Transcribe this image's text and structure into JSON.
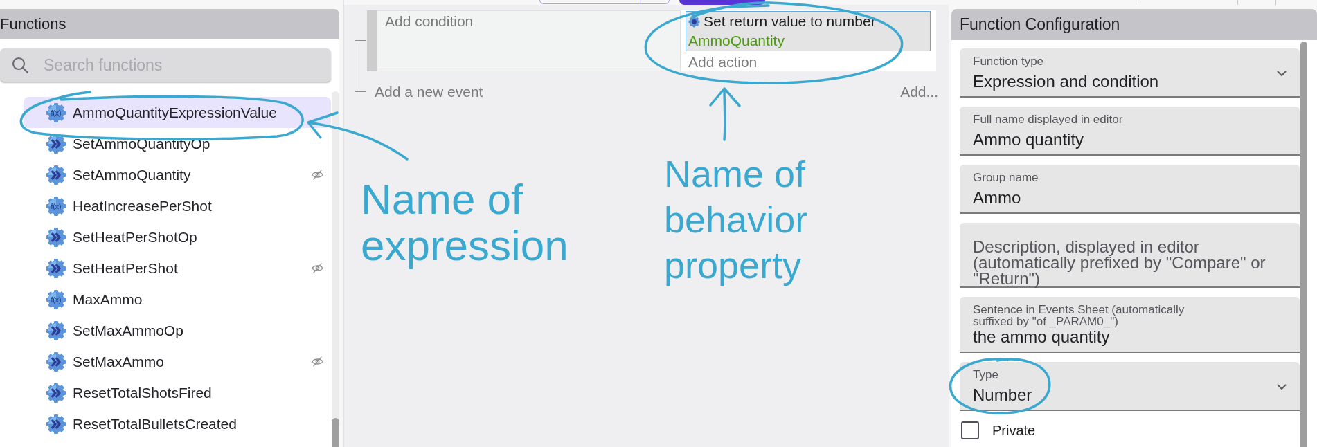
{
  "functions_panel": {
    "title": "Functions",
    "search": {
      "placeholder": "Search functions"
    },
    "items": [
      {
        "name": "AmmoQuantityExpressionValue",
        "kind": "expression",
        "icon_text": "f(x)",
        "selected": true,
        "private": false
      },
      {
        "name": "SetAmmoQuantityOp",
        "kind": "action",
        "selected": false,
        "private": false
      },
      {
        "name": "SetAmmoQuantity",
        "kind": "action",
        "selected": false,
        "private": true
      },
      {
        "name": "HeatIncreasePerShot",
        "kind": "expression",
        "icon_text": "f(x)",
        "selected": false,
        "private": false
      },
      {
        "name": "SetHeatPerShotOp",
        "kind": "action",
        "selected": false,
        "private": false
      },
      {
        "name": "SetHeatPerShot",
        "kind": "action",
        "selected": false,
        "private": true
      },
      {
        "name": "MaxAmmo",
        "kind": "expression",
        "icon_text": "f(x)",
        "selected": false,
        "private": false
      },
      {
        "name": "SetMaxAmmoOp",
        "kind": "action",
        "selected": false,
        "private": false
      },
      {
        "name": "SetMaxAmmo",
        "kind": "action",
        "selected": false,
        "private": true
      },
      {
        "name": "ResetTotalShotsFired",
        "kind": "action",
        "selected": false,
        "private": false
      },
      {
        "name": "ResetTotalBulletsCreated",
        "kind": "action",
        "selected": false,
        "private": false
      }
    ]
  },
  "events_sheet": {
    "event": {
      "add_condition": "Add condition",
      "actions": [
        {
          "text": "Set return value to number",
          "value": "AmmoQuantity",
          "selected": true
        }
      ],
      "add_action": "Add action"
    },
    "add_event": "Add a new event",
    "add_menu": "Add..."
  },
  "configuration_panel": {
    "title": "Function Configuration",
    "fields": [
      {
        "kind": "select",
        "label": "Function type",
        "value": "Expression and condition"
      },
      {
        "kind": "text",
        "label": "Full name displayed in editor",
        "value": "Ammo quantity"
      },
      {
        "kind": "text",
        "label": "Group name",
        "value": "Ammo"
      },
      {
        "kind": "multiline",
        "placeholder": "Description, displayed in editor (automatically prefixed by \"Compare\" or \"Return\")"
      },
      {
        "kind": "text",
        "label": "Sentence in Events Sheet (automatically suffixed by \"of _PARAM0_\")",
        "value": "the ammo quantity"
      },
      {
        "kind": "select",
        "label": "Type",
        "value": "Number"
      }
    ],
    "private": {
      "label": "Private",
      "checked": false
    }
  },
  "annotations": [
    {
      "text": "Name of expression"
    },
    {
      "text": "Name of behavior property"
    }
  ]
}
